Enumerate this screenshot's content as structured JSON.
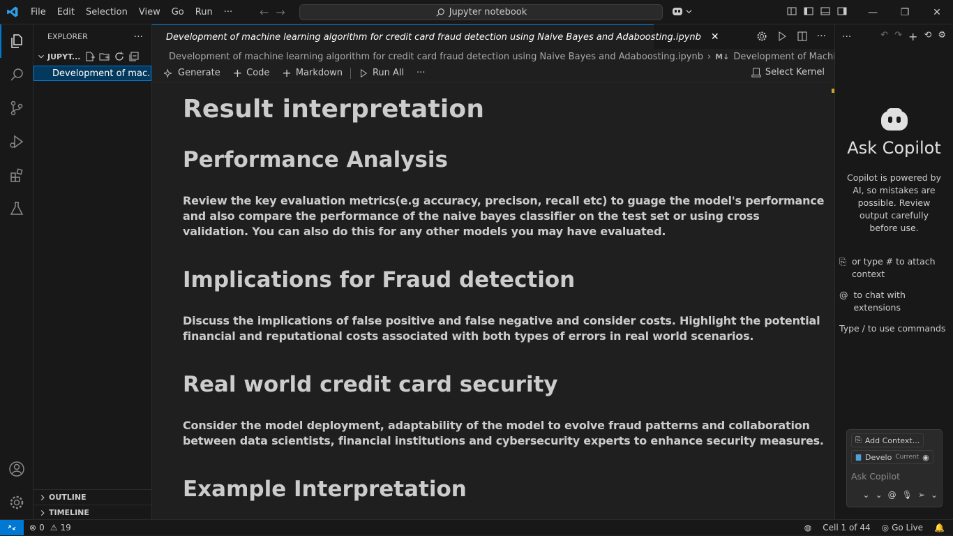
{
  "menu": [
    "File",
    "Edit",
    "Selection",
    "View",
    "Go",
    "Run",
    "···"
  ],
  "search": {
    "text": "Jupyter notebook"
  },
  "explorer": {
    "title": "EXPLORER",
    "folder": "JUPYT...",
    "file": "Development of mac..."
  },
  "sidebar_sections": {
    "outline": "OUTLINE",
    "timeline": "TIMELINE"
  },
  "tab": {
    "title": "Development of machine learning algorithm for credit card fraud detection using Naive Bayes and Adaboosting.ipynb"
  },
  "breadcrumb": {
    "file": "Development of machine learning algorithm for credit card fraud detection using Naive Bayes and Adaboosting.ipynb",
    "md_badge": "M↓",
    "section": "Development of Machine learning Algor"
  },
  "toolbar": {
    "generate": "Generate",
    "code": "Code",
    "markdown": "Markdown",
    "run_all": "Run All",
    "more": "···",
    "kernel": "Select Kernel"
  },
  "notebook": {
    "h1": "Result interpretation",
    "h2_performance": "Performance Analysis",
    "p_performance": "Review the key evaluation metrics(e.g accuracy, precison, recall etc) to guage the model's performance and also compare the performance of the naive bayes classifier on the test set or using cross validation. You can also do this for any other models you may have evaluated.",
    "h2_implications": "Implications for Fraud detection",
    "p_implications": "Discuss the implications of false positive and false negative and consider costs. Highlight the potential financial and reputational costs associated with both types of errors in real world scenarios.",
    "h2_security": "Real world credit card security",
    "p_security": "Consider the model deployment, adaptability of the model to evolve fraud patterns and collaboration between data scientists, financial institutions and cybersecurity experts to enhance security measures.",
    "h2_example": "Example Interpretation"
  },
  "chat": {
    "title": "Ask Copilot",
    "description": "Copilot is powered by AI, so mistakes are possible. Review output carefully before use.",
    "hint_attach": "or type # to attach context",
    "hint_extensions": "to chat with extensions",
    "hint_commands": "Type / to use commands",
    "add_context": "Add Context...",
    "current_file": "Develo",
    "current_label": "Current",
    "placeholder": "Ask Copilot"
  },
  "status": {
    "errors": "0",
    "warnings": "19",
    "cell": "Cell 1 of 44",
    "golive": "Go Live"
  },
  "colors": {
    "accent": "#0078d4",
    "bg": "#1f1f1f",
    "sidebar": "#181818"
  }
}
